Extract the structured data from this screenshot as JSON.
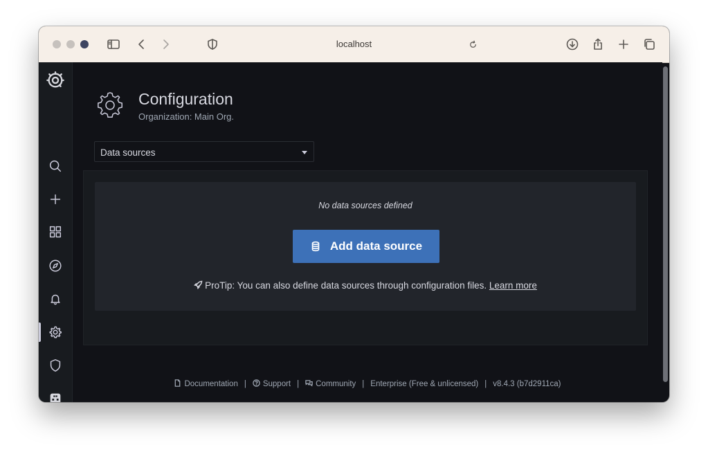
{
  "browser": {
    "url": "localhost",
    "toolbar_icons": [
      "sidebar-icon",
      "back-icon",
      "forward-icon",
      "shield-icon",
      "reload-icon",
      "download-icon",
      "share-icon",
      "new-tab-icon",
      "tabs-icon"
    ]
  },
  "sidebar": {
    "items": [
      {
        "name": "grafana-logo-icon"
      },
      {
        "name": "search-icon"
      },
      {
        "name": "plus-icon"
      },
      {
        "name": "dashboards-icon"
      },
      {
        "name": "explore-icon"
      },
      {
        "name": "alerting-icon"
      },
      {
        "name": "configuration-icon",
        "active": true
      },
      {
        "name": "server-admin-shield-icon"
      },
      {
        "name": "user-avatar-icon"
      },
      {
        "name": "help-icon"
      }
    ]
  },
  "page": {
    "title": "Configuration",
    "subtitle": "Organization: Main Org.",
    "icon": "cog-icon"
  },
  "tab_select": {
    "selected": "Data sources"
  },
  "empty_state": {
    "title": "No data sources defined",
    "button_label": "Add data source",
    "button_icon": "database-icon",
    "protip_text": "ProTip: You can also define data sources through configuration files.",
    "protip_link": "Learn more"
  },
  "footer": {
    "documentation": "Documentation",
    "support": "Support",
    "community": "Community",
    "edition": "Enterprise (Free & unlicensed)",
    "version": "v8.4.3 (b7d2911ca)"
  },
  "colors": {
    "accent": "#3d71b8",
    "background": "#111217",
    "panel": "#181b1f",
    "text": "#d8d9e1"
  }
}
